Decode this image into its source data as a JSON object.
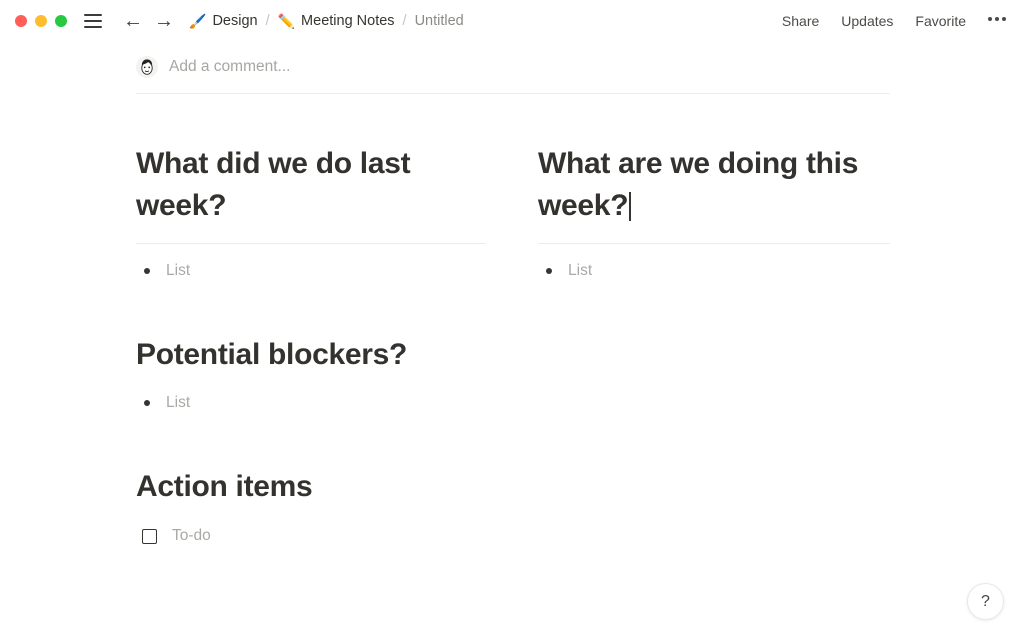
{
  "window": {
    "traffic_lights": [
      {
        "name": "close",
        "color": "#ff5f57"
      },
      {
        "name": "minimize",
        "color": "#febc2e"
      },
      {
        "name": "maximize",
        "color": "#28c840"
      }
    ],
    "sidebar_toggle_icon": "hamburger-menu-icon",
    "nav": {
      "back_icon": "←",
      "forward_icon": "→"
    }
  },
  "breadcrumb": {
    "items": [
      {
        "emoji": "🖌️",
        "icon_name": "paintbrush-emoji",
        "label": "Design",
        "muted": false
      },
      {
        "emoji": "✏️",
        "icon_name": "pencil-emoji",
        "label": "Meeting Notes",
        "muted": false
      },
      {
        "emoji": "",
        "icon_name": "",
        "label": "Untitled",
        "muted": true
      }
    ],
    "separator": "/"
  },
  "header_actions": {
    "share": "Share",
    "updates": "Updates",
    "favorite": "Favorite",
    "more_icon": "more-options-icon"
  },
  "comment": {
    "avatar_name": "user-avatar",
    "placeholder": "Add a comment..."
  },
  "document": {
    "columns": [
      {
        "blocks": [
          {
            "type": "heading",
            "text": "What did we do last week?",
            "has_rule": true,
            "has_caret": false,
            "items": [
              {
                "type": "bullet",
                "placeholder": "List"
              }
            ]
          },
          {
            "type": "heading",
            "text": "Potential blockers?",
            "has_rule": false,
            "has_caret": false,
            "items": [
              {
                "type": "bullet",
                "placeholder": "List"
              }
            ]
          },
          {
            "type": "heading",
            "text": "Action items",
            "has_rule": false,
            "has_caret": false,
            "items": [
              {
                "type": "todo",
                "placeholder": "To-do"
              }
            ]
          }
        ]
      },
      {
        "blocks": [
          {
            "type": "heading",
            "text": "What are we doing this week?",
            "has_rule": true,
            "has_caret": true,
            "items": [
              {
                "type": "bullet",
                "placeholder": "List"
              }
            ]
          }
        ]
      }
    ]
  },
  "help": {
    "label": "?",
    "icon_name": "question-mark-icon"
  },
  "colors": {
    "text": "#37352f",
    "placeholder": "#a9a9a5",
    "rule": "#ededeb",
    "background": "#ffffff"
  }
}
